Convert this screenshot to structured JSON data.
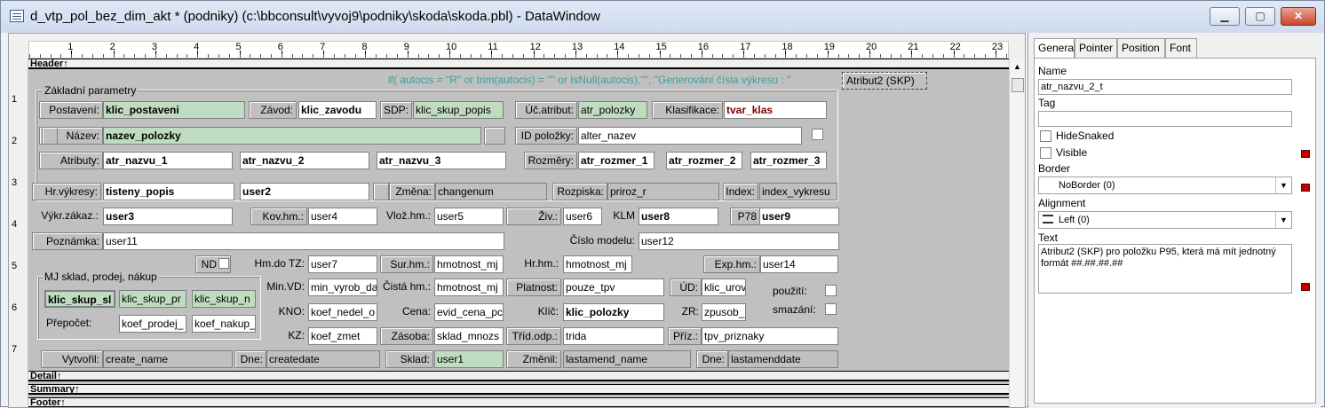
{
  "window": {
    "title": "d_vtp_pol_bez_dim_akt * (podniky) (c:\\bbconsult\\vyvoj9\\podniky\\skoda\\skoda.pbl) - DataWindow",
    "minimize": "▁",
    "maximize": "▢",
    "close": "✕"
  },
  "ruler": {
    "h_numbers": [
      "1",
      "2",
      "3",
      "4",
      "5",
      "6",
      "7",
      "8",
      "9",
      "10",
      "11",
      "12",
      "13",
      "14",
      "15",
      "16",
      "17",
      "18",
      "19",
      "20",
      "21",
      "22",
      "23"
    ],
    "v_numbers": [
      "1",
      "2",
      "3",
      "4",
      "5",
      "6",
      "7"
    ]
  },
  "bands": {
    "header": "Header↑",
    "detail": "Detail↑",
    "summary": "Summary↑",
    "footer": "Footer↑"
  },
  "canvas": {
    "expression": "if(  autocis = \"R\" or trim(autocis) = \"\" or IsNull(autocis),\"\", \"Generování čísla výkresu : \"",
    "selected_text": "Atribut2 (SKP)",
    "group_zakladni": "Základní parametry",
    "group_mj": "MJ sklad, prodej, nákup",
    "labels": {
      "postaveni": "Postavení:",
      "zavod": "Závod:",
      "sdp": "SDP:",
      "uc_atribut": "Úč.atribut:",
      "klasifikace": "Klasifikace:",
      "nazev": "Název:",
      "id_polozky": "ID položky:",
      "atributy": "Atributy:",
      "rozmery": "Rozměry:",
      "hr_vykresy": "Hr.výkresy:",
      "zmena": "Změna:",
      "rozpiska": "Rozpiska:",
      "index": "Index:",
      "vykr_zakaz": "Výkr.zákaz.:",
      "kov_hm": "Kov.hm.:",
      "vloz_hm": "Vlož.hm.:",
      "ziv": "Živ.:",
      "klm": "KLM",
      "p78": "P78",
      "poznamka": "Poznámka:",
      "cislo_modelu": "Číslo modelu:",
      "nd": "ND",
      "hm_do_tz": "Hm.do TZ:",
      "sur_hm": "Sur.hm.:",
      "hr_hm": "Hr.hm.:",
      "exp_hm": "Exp.hm.:",
      "min_vd": "Min.VD:",
      "cista_hm": "Čistá hm.:",
      "platnost": "Platnost:",
      "ud": "ÚD:",
      "pouziti": "použití:",
      "prepocet": "Přepočet:",
      "kno": "KNO:",
      "cena": "Cena:",
      "klic": "Klíč:",
      "zr": "ZR:",
      "smazani": "smazání:",
      "kz": "KZ:",
      "zasoba": "Zásoba:",
      "trid_odp": "Tříd.odp.:",
      "priz": "Příz.:",
      "vytvoril": "Vytvořil:",
      "dne1": "Dne:",
      "sklad": "Sklad:",
      "zmenil": "Změnil:",
      "dne2": "Dne:"
    },
    "columns": {
      "klic_postaveni": "klic_postaveni",
      "klic_zavodu": "klic_zavodu",
      "klic_skup_popis": "klic_skup_popis",
      "atr_polozky": "atr_polozky",
      "tvar_klas": "tvar_klas",
      "nazev_polozky": "nazev_polozky",
      "alter_nazev": "alter_nazev",
      "atr_nazvu_1": "atr_nazvu_1",
      "atr_nazvu_2": "atr_nazvu_2",
      "atr_nazvu_3": "atr_nazvu_3",
      "atr_rozmer_1": "atr_rozmer_1",
      "atr_rozmer_2": "atr_rozmer_2",
      "atr_rozmer_3": "atr_rozmer_3",
      "tisteny_popis": "tisteny_popis",
      "user2": "user2",
      "changenum": "changenum",
      "priroz_r": "priroz_r",
      "index_vykresu": "index_vykresu",
      "user3": "user3",
      "user4": "user4",
      "user5": "user5",
      "user6": "user6",
      "user8": "user8",
      "user9": "user9",
      "user11": "user11",
      "user12": "user12",
      "user7": "user7",
      "hmotnost_mj1": "hmotnost_mj",
      "hmotnost_mj2": "hmotnost_mj",
      "user14": "user14",
      "min_vyrob_da": "min_vyrob_da",
      "hmotnost_mj3": "hmotnost_mj",
      "pouze_tpv": "pouze_tpv",
      "klic_uro": "klic_urov",
      "klic_skup_sl": "klic_skup_sl",
      "klic_skup_pr": "klic_skup_pr",
      "klic_skup_n": "klic_skup_n",
      "koef_prodej": "koef_prodej_",
      "koef_nakup": "koef_nakup_",
      "koef_nedel_o": "koef_nedel_o",
      "evid_cena_pc": "evid_cena_pc",
      "klic_polozky": "klic_polozky",
      "zpusob": "zpusob_",
      "koef_zmet": "koef_zmet",
      "sklad_mnozs": "sklad_mnozs",
      "trida": "trida",
      "tpv_priznaky": "tpv_priznaky",
      "create_name": "create_name",
      "createdate": "createdate",
      "user1": "user1",
      "lastamend_name": "lastamend_name",
      "lastamenddate": "lastamenddate"
    }
  },
  "properties": {
    "tabs": [
      "General",
      "Pointer",
      "Position",
      "Font"
    ],
    "name_label": "Name",
    "name_value": "atr_nazvu_2_t",
    "tag_label": "Tag",
    "tag_value": "",
    "hidesnaked_label": "HideSnaked",
    "visible_label": "Visible",
    "border_label": "Border",
    "border_value": "NoBorder (0)",
    "alignment_label": "Alignment",
    "alignment_value": "Left (0)",
    "text_label": "Text",
    "text_value": "Atribut2 (SKP) pro položku P95, která má mít jednotný formát ##.##.##.##"
  }
}
